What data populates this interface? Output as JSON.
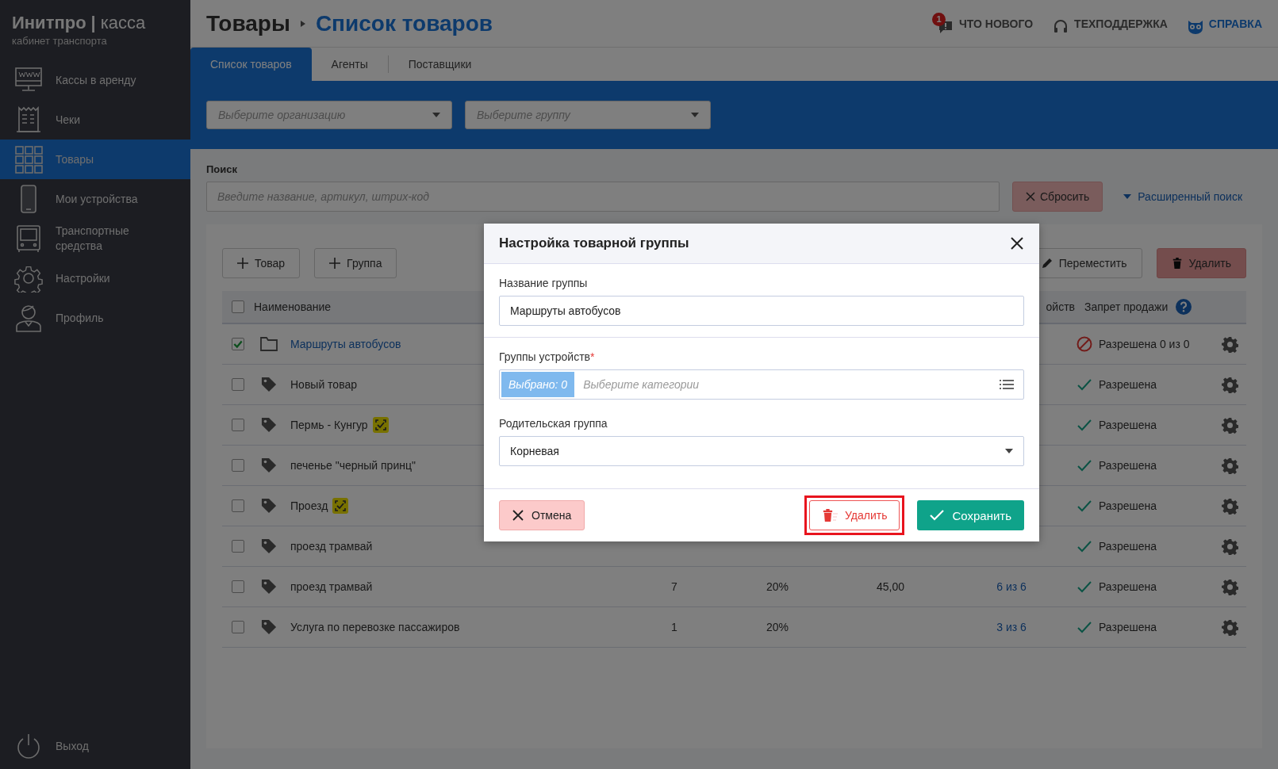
{
  "brand": {
    "name": "Инитпро",
    "separator": "|",
    "product": "касса",
    "subtitle": "кабинет транспорта"
  },
  "sidebar": {
    "items": [
      {
        "label": "Кассы в аренду",
        "selected": false
      },
      {
        "label": "Чеки",
        "selected": false
      },
      {
        "label": "Товары",
        "selected": true
      },
      {
        "label": "Мои устройства",
        "selected": false
      },
      {
        "label": "Транспортные средства",
        "selected": false
      },
      {
        "label": "Настройки",
        "selected": false
      },
      {
        "label": "Профиль",
        "selected": false
      }
    ],
    "logout": "Выход"
  },
  "breadcrumb": {
    "section": "Товары",
    "page": "Список товаров"
  },
  "top_links": [
    {
      "label": "ЧТО НОВОГО",
      "badge": "1",
      "kind": "plain"
    },
    {
      "label": "ТЕХПОДДЕРЖКА",
      "kind": "plain"
    },
    {
      "label": "СПРАВКА",
      "kind": "accent"
    }
  ],
  "tabs": [
    {
      "label": "Список товаров",
      "selected": true
    },
    {
      "label": "Агенты",
      "selected": false
    },
    {
      "label": "Поставщики",
      "selected": false
    }
  ],
  "filters": [
    {
      "placeholder": "Выберите организацию"
    },
    {
      "placeholder": "Выберите группу"
    }
  ],
  "search": {
    "label": "Поиск",
    "placeholder": "Введите название, артикул, штрих-код",
    "reset": "Сбросить",
    "advanced": "Расширенный поиск"
  },
  "toolbar": {
    "add": [
      "Товар",
      "Группа"
    ],
    "move": "Переместить",
    "delete": "Удалить"
  },
  "table": {
    "select_all": false,
    "columns": {
      "name": "Наименование",
      "devices": "ойств",
      "ban": "Запрет продажи"
    },
    "rows": [
      {
        "checked": true,
        "kind": "folder",
        "name": "Маршруты автобусов",
        "tagged": false,
        "sale_allowed": false,
        "ban": "Разрешена 0 из 0"
      },
      {
        "checked": false,
        "kind": "item",
        "name": "Новый товар",
        "tagged": false,
        "sale_allowed": true,
        "ban": "Разрешена"
      },
      {
        "checked": false,
        "kind": "item",
        "name": "Пермь - Кунгур",
        "tagged": true,
        "sale_allowed": true,
        "ban": "Разрешена"
      },
      {
        "checked": false,
        "kind": "item",
        "name": "печенье \"черный принц\"",
        "tagged": false,
        "sale_allowed": true,
        "ban": "Разрешена"
      },
      {
        "checked": false,
        "kind": "item",
        "name": "Проезд",
        "tagged": true,
        "sale_allowed": true,
        "ban": "Разрешена"
      },
      {
        "checked": false,
        "kind": "item",
        "name": "проезд трамвай",
        "tagged": false,
        "sale_allowed": true,
        "ban": "Разрешена"
      },
      {
        "checked": false,
        "kind": "item",
        "name": "проезд трамвай",
        "tagged": false,
        "qty": "7",
        "vat": "20%",
        "price": "45,00",
        "devices": "6 из 6",
        "sale_allowed": true,
        "ban": "Разрешена"
      },
      {
        "checked": false,
        "kind": "item",
        "name": "Услуга по перевозке пассажиров",
        "tagged": false,
        "qty": "1",
        "vat": "20%",
        "devices": "3 из 6",
        "sale_allowed": true,
        "ban": "Разрешена"
      }
    ]
  },
  "modal": {
    "title": "Настройка товарной группы",
    "name_label": "Название группы",
    "name_value": "Маршруты автобусов",
    "devices_label": "Группы устройств",
    "required": "*",
    "chip": "Выбрано: 0",
    "devices_placeholder": "Выберите категории",
    "parent_label": "Родительская группа",
    "parent_value": "Корневая",
    "cancel": "Отмена",
    "delete": "Удалить",
    "save": "Сохранить",
    "delete_highlighted": true
  }
}
